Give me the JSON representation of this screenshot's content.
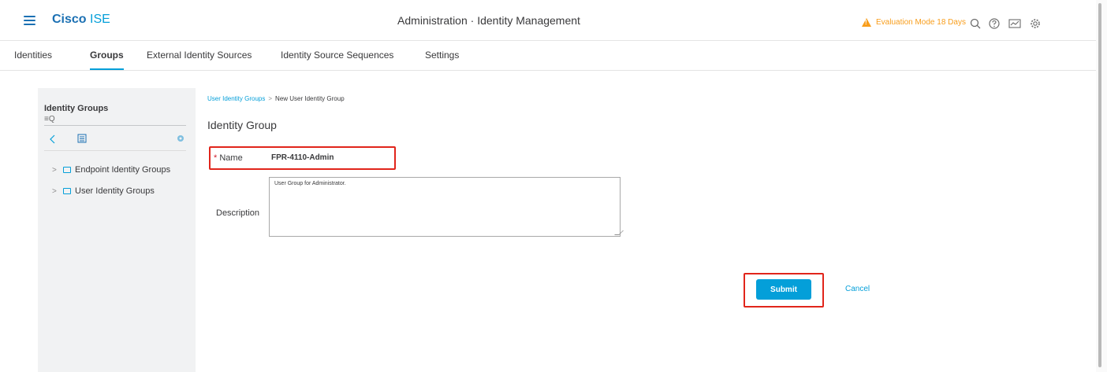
{
  "header": {
    "brand_bold": "Cisco",
    "brand_rest": "ISE",
    "title": "Administration · Identity Management",
    "evaluation": "Evaluation Mode 18 Days",
    "icons": [
      "search-icon",
      "help-icon",
      "dashboard-icon",
      "gear-icon"
    ],
    "accent_color": "#049fd9",
    "warning_color": "#f89d1b"
  },
  "tabs": [
    {
      "label": "Identities"
    },
    {
      "label": "Groups",
      "active": true
    },
    {
      "label": "External Identity Sources"
    },
    {
      "label": "Identity Source Sequences"
    },
    {
      "label": "Settings"
    }
  ],
  "sidebar": {
    "title": "Identity Groups",
    "search_placeholder": "≡Q",
    "items": [
      {
        "label": "Endpoint Identity Groups"
      },
      {
        "label": "User Identity Groups"
      }
    ]
  },
  "breadcrumb": {
    "link": "User Identity Groups",
    "separator": ">",
    "current": "New User Identity Group"
  },
  "form": {
    "title": "Identity Group",
    "name_required_mark": "*",
    "name_label": "Name",
    "name_value": "FPR-4110-Admin",
    "description_label": "Description",
    "description_value": "User Group for Administrator.",
    "submit_label": "Submit",
    "cancel_label": "Cancel",
    "highlight_color": "#e1251b"
  }
}
